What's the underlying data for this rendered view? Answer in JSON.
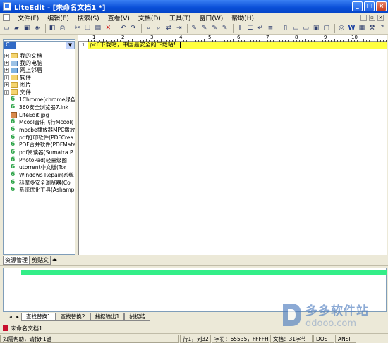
{
  "window": {
    "title": "LiteEdit - [未命名文档1 *]"
  },
  "menu": [
    "文件(F)",
    "编辑(E)",
    "搜索(S)",
    "查看(V)",
    "文档(D)",
    "工具(T)",
    "窗口(W)",
    "帮助(H)"
  ],
  "drive": {
    "value": "C:"
  },
  "tree": [
    {
      "label": "我的文档",
      "icon": "folder-icon",
      "kind": "folder"
    },
    {
      "label": "我的电脑",
      "icon": "computer-icon",
      "kind": "pc"
    },
    {
      "label": "网上邻居",
      "icon": "network-icon",
      "kind": "net"
    },
    {
      "label": "软件",
      "icon": "folder-icon",
      "kind": "folder"
    },
    {
      "label": "图片",
      "icon": "folder-icon",
      "kind": "folder"
    },
    {
      "label": "文件",
      "icon": "folder-icon",
      "kind": "folder"
    }
  ],
  "files": [
    "1Chrome(chrome绿色",
    "360安全浏览器7.lnk",
    "LiteEdit.jpg",
    "Mcool音乐飞行Mcool(",
    "mpcbe播放器MPC播放",
    "pdf打印软件(PDFCrea",
    "PDF合并软件(PDFMate",
    "pdf阅读器(Sumatra P",
    "PhotoPad(轻量级图",
    "utorrent中文版(Tor",
    "Windows Repair(系统",
    "科摩多安全浏览器(Co",
    "系统优化工具(Ashamp"
  ],
  "left_tabs": [
    "资源管理",
    "剪贴文"
  ],
  "editor": {
    "line_number": "1",
    "text": "pc6下载站，中国最安全的下载站！"
  },
  "ruler": [
    "1",
    "2",
    "3",
    "4",
    "5",
    "6",
    "7",
    "8",
    "9",
    "10"
  ],
  "output": {
    "line_number": "1"
  },
  "bottom_tabs": [
    "查找替换1",
    "查找替换2",
    "捕捉输出1",
    "捕捉结"
  ],
  "doc_tab": "未命名文档1",
  "status": {
    "help": "如需帮助，请按F1键",
    "position": "行1，列32",
    "chars": "字符：65535，FFFFH",
    "doc_size": "文档：31字节",
    "encoding": "DOS",
    "mode": "ANSI"
  },
  "watermark": {
    "cn": "多多软件站",
    "url": "ddooo.com"
  }
}
